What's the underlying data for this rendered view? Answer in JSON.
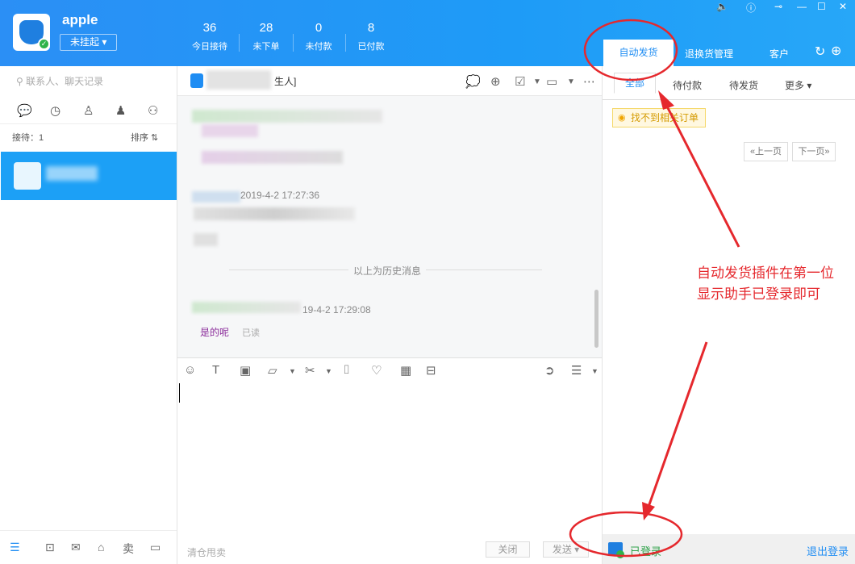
{
  "header": {
    "username": "apple",
    "status": "未挂起",
    "stats": [
      {
        "num": "36",
        "label": "今日接待"
      },
      {
        "num": "28",
        "label": "未下单"
      },
      {
        "num": "0",
        "label": "未付款"
      },
      {
        "num": "8",
        "label": "已付款"
      }
    ],
    "tabs": [
      "自动发货",
      "退换货管理",
      "客户"
    ],
    "window_controls": [
      "speaker-icon",
      "help-icon",
      "pin-icon",
      "minimize-icon",
      "maximize-icon",
      "close-icon"
    ]
  },
  "left": {
    "search_placeholder": "联系人、聊天记录",
    "waiting": "接待：1",
    "sort": "排序 ⇅",
    "bottom_icons": [
      "menu-icon",
      "plugin-icon",
      "mail-icon",
      "shop-icon",
      "sell-icon",
      "panel-icon"
    ],
    "bottom_sell": "卖"
  },
  "chat": {
    "title_suffix": "生人]",
    "timestamp1": "2019-4-2 17:27:36",
    "history_divider": "以上为历史消息",
    "timestamp2": "19-4-2 17:29:08",
    "last_message": "是的呢",
    "read_status": "已读",
    "input_hint": "清仓甩卖",
    "close_button": "关闭",
    "send_button": "发送"
  },
  "right": {
    "subtabs": [
      "全部",
      "待付款",
      "待发货",
      "更多"
    ],
    "not_found": "找不到相关订单",
    "prev_page": "«上一页",
    "next_page": "下一页»",
    "annotation": "自动发货插件在第一位\n显示助手已登录即可",
    "logged_in": "已登录",
    "logout": "退出登录"
  },
  "colors": {
    "brand_blue": "#1f8df3",
    "annotation_red": "#e5282d",
    "success_green": "#2fa24a"
  }
}
